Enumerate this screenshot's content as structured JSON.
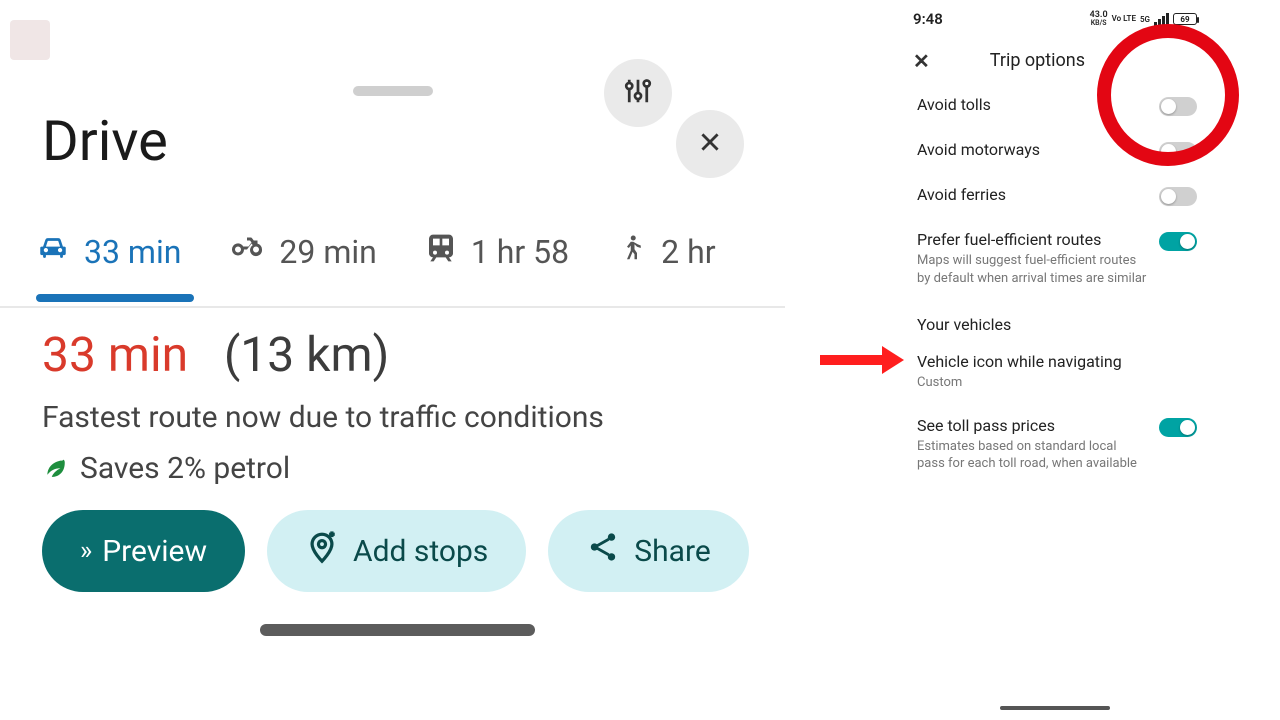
{
  "left": {
    "title": "Drive",
    "tabs": [
      {
        "mode": "car",
        "label": "33 min",
        "active": true
      },
      {
        "mode": "moto",
        "label": "29 min",
        "active": false
      },
      {
        "mode": "transit",
        "label": "1 hr 58",
        "active": false
      },
      {
        "mode": "walk",
        "label": "2 hr",
        "active": false
      }
    ],
    "route": {
      "time": "33 min",
      "distance": "(13 km)",
      "subtitle": "Fastest route now due to traffic conditions",
      "petrol": "Saves 2% petrol"
    },
    "actions": {
      "preview": "Preview",
      "add_stops": "Add stops",
      "share": "Share"
    }
  },
  "phone": {
    "status": {
      "time": "9:48",
      "net": "43.0",
      "net_unit": "KB/S",
      "lte": "Vo LTE",
      "fiveg": "5G",
      "battery": "69"
    },
    "header": {
      "title": "Trip options"
    },
    "opts": {
      "tolls": {
        "label": "Avoid tolls",
        "on": false
      },
      "motor": {
        "label": "Avoid motorways",
        "on": false
      },
      "ferries": {
        "label": "Avoid ferries",
        "on": false
      },
      "fuel": {
        "label": "Prefer fuel-efficient routes",
        "sub": "Maps will suggest fuel-efficient routes by default when arrival times are similar",
        "on": true
      },
      "vehicles_head": "Your vehicles",
      "vicon": {
        "label": "Vehicle icon while navigating",
        "sub": "Custom"
      },
      "tollpass": {
        "label": "See toll pass prices",
        "sub": "Estimates based on standard local pass for each toll road, when available",
        "on": true
      }
    }
  }
}
